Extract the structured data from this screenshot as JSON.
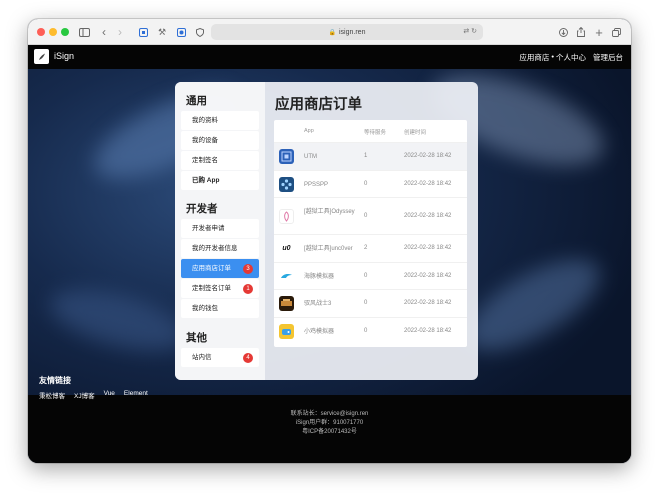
{
  "browser": {
    "url": "isign.ren"
  },
  "nav": {
    "brand": "iSign",
    "links": [
      "应用商店",
      "个人中心",
      "管理后台"
    ],
    "separator": "•"
  },
  "sidebar": {
    "sections": [
      {
        "title": "通用",
        "items": [
          "我的资料",
          "我的设备",
          "定制签名",
          "已购 App"
        ]
      },
      {
        "title": "开发者",
        "items": [
          "开发者申请",
          "我的开发者信息",
          "应用商店订单",
          "定制签名订单",
          "我的钱包"
        ]
      },
      {
        "title": "其他",
        "items": [
          "站内信"
        ]
      }
    ],
    "badges": {
      "app_store_orders": "3",
      "custom_sign_orders": "1",
      "messages": "4"
    }
  },
  "main": {
    "title": "应用商店订单",
    "columns": [
      "App",
      "等待服务",
      "创建时间"
    ],
    "rows": [
      {
        "name": "UTM",
        "count": "1",
        "time": "2022-02-28 18:42",
        "icon": "utm-icon"
      },
      {
        "name": "PPSSPP",
        "count": "0",
        "time": "2022-02-28 18:42",
        "icon": "ppsspp-icon"
      },
      {
        "name": "[越狱工具]Odyssey",
        "count": "0",
        "time": "2022-02-28 18:42",
        "icon": "odyssey-icon"
      },
      {
        "name": "[越狱工具]unc0ver",
        "count": "2",
        "time": "2022-02-28 18:42",
        "icon": "unc0ver-icon"
      },
      {
        "name": "海豚模拟器",
        "count": "0",
        "time": "2022-02-28 18:42",
        "icon": "dolphin-icon"
      },
      {
        "name": "驭风战士3",
        "count": "0",
        "time": "2022-02-28 18:42",
        "icon": "game-icon"
      },
      {
        "name": "小鸡模拟器",
        "count": "0",
        "time": "2022-02-28 18:42",
        "icon": "chick-emulator-icon"
      }
    ]
  },
  "footer": {
    "friend_title": "友情链接",
    "friend_links": [
      "秉松博客",
      "XJ博客",
      "Vue",
      "Element"
    ],
    "contact": "联系站长：service@isign.ren",
    "qq_group": "iSign用户群：910071770",
    "icp": "粤ICP备20071432号"
  },
  "colors": {
    "accent": "#3b8ff0",
    "badge": "#e53935"
  }
}
